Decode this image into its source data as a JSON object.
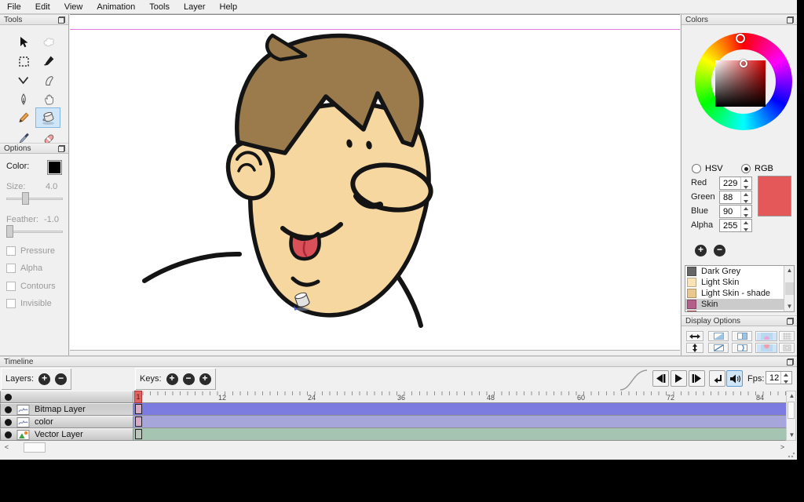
{
  "menu": {
    "items": [
      "File",
      "Edit",
      "View",
      "Animation",
      "Tools",
      "Layer",
      "Help"
    ]
  },
  "tools_panel": {
    "title": "Tools",
    "tools": [
      "move",
      "clear",
      "select",
      "brush",
      "polyline",
      "smudge",
      "pen",
      "hand",
      "pencil",
      "bucket",
      "eyedropper",
      "eraser"
    ],
    "active_tool": "bucket"
  },
  "options_panel": {
    "title": "Options",
    "color_label": "Color:",
    "size_label": "Size:",
    "size_value": "4.0",
    "feather_label": "Feather:",
    "feather_value": "-1.0",
    "checkboxes": [
      "Pressure",
      "Alpha",
      "Contours",
      "Invisible"
    ]
  },
  "colors_panel": {
    "title": "Colors",
    "hsv_label": "HSV",
    "rgb_label": "RGB",
    "selected_mode": "RGB",
    "channels": [
      {
        "label": "Red",
        "value": "229"
      },
      {
        "label": "Green",
        "value": "88"
      },
      {
        "label": "Blue",
        "value": "90"
      },
      {
        "label": "Alpha",
        "value": "255"
      }
    ],
    "current_color": "#e5585a",
    "swatches": [
      {
        "name": "Dark Grey",
        "color": "#666666"
      },
      {
        "name": "Light Skin",
        "color": "#f9e3b7"
      },
      {
        "name": "Light Skin - shade",
        "color": "#e9c globally"
      },
      {
        "name": "Skin",
        "color": "#b2608a"
      },
      {
        "name": "",
        "color": "#cf4a52"
      }
    ],
    "selected_swatch": "Skin"
  },
  "display_options": {
    "title": "Display Options"
  },
  "canvas": {
    "camera_line_color": "#e878e8",
    "colors": {
      "skin": "#f7d7a0",
      "hair": "#9b7b4b",
      "tongue": "#d95058",
      "outline": "#141414"
    }
  },
  "timeline": {
    "title": "Timeline",
    "layers_label": "Layers:",
    "keys_label": "Keys:",
    "fps_label": "Fps:",
    "fps_value": "12",
    "current_frame": "1",
    "ruler_labels": [
      "12",
      "24",
      "36",
      "48",
      "60",
      "72",
      "84"
    ],
    "layers": [
      {
        "name": "Bitmap Layer",
        "track_color": "#7b7be0",
        "key_color": "#d9a9c9",
        "selected": true
      },
      {
        "name": "color",
        "track_color": "#a6a6da",
        "key_color": "#d9a9c9",
        "selected": false
      },
      {
        "name": "Vector Layer",
        "track_color": "#a6c4b2",
        "key_color": "#b9c6ba",
        "selected": false
      }
    ]
  },
  "glyphs": {
    "plus": "+",
    "minus": "−",
    "left": "<",
    "right": ">",
    "up": "▲",
    "down": "▼"
  }
}
